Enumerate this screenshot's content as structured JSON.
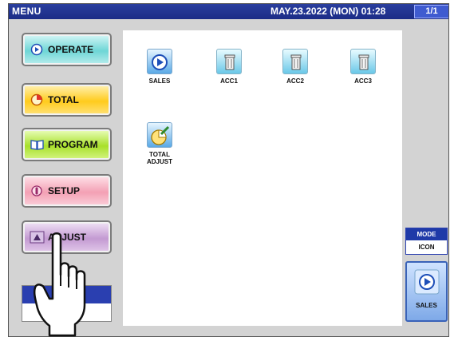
{
  "title": "MENU",
  "datetime": "MAY.23.2022 (MON)  01:28",
  "page": "1/1",
  "menu": {
    "operate": "OPERATE",
    "total": "TOTAL",
    "program": "PROGRAM",
    "setup": "SETUP",
    "adjust": "ADJUST"
  },
  "icons": {
    "sales": "SALES",
    "acc1": "ACC1",
    "acc2": "ACC2",
    "acc3": "ACC3",
    "total_adjust_line1": "TOTAL",
    "total_adjust_line2": "ADJUST"
  },
  "mode": {
    "label": "MODE",
    "value": "ICON"
  },
  "sales_button": "SALES"
}
